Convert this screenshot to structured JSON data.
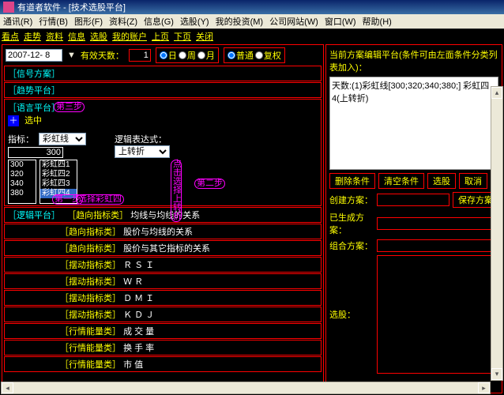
{
  "window": {
    "title": "有道者软件 - [技术选股平台]"
  },
  "menu": [
    "通讯(R)",
    "行情(B)",
    "图形(F)",
    "资料(Z)",
    "信息(G)",
    "选股(Y)",
    "我的投资(M)",
    "公司网站(W)",
    "窗口(W)",
    "帮助(H)"
  ],
  "toolbar": [
    "看点",
    "走势",
    "资料",
    "信息",
    "选股",
    "我的账户",
    "上页",
    "下页",
    "关闭"
  ],
  "top": {
    "date": "2007-12- 8",
    "days_label": "有效天数：",
    "days_value": "1",
    "period": {
      "day": "日",
      "week": "周",
      "month": "月"
    },
    "mode": {
      "normal": "普通",
      "adjusted": "复权"
    }
  },
  "sections": {
    "signal": "［信号方案］",
    "trend": "［趋势平台］",
    "lang": "［语言平台］",
    "logic": "［逻辑平台］"
  },
  "lang_panel": {
    "select_label": "选中",
    "indicator_label": "指标：",
    "indicator_value": "彩虹线",
    "num_value": "300",
    "list1": [
      "300",
      "320",
      "340",
      "380"
    ],
    "list2": [
      "彩虹四1",
      "彩虹四2",
      "彩虹四3",
      "彩虹四4"
    ],
    "list2_selected": 3,
    "logic_label": "逻辑表达式：",
    "logic_value": "上转折"
  },
  "annotations": {
    "step1": "第一步",
    "step2": "第二步",
    "step3": "第三步",
    "pick_ch4": "选择彩虹四",
    "click_sel": "点击选择上转折"
  },
  "categories": [
    {
      "cat": "［趋向指标类］",
      "desc": "均线与均线的关系"
    },
    {
      "cat": "［趋向指标类］",
      "desc": "股价与均线的关系"
    },
    {
      "cat": "［趋向指标类］",
      "desc": "股价与其它指标的关系"
    },
    {
      "cat": "［摆动指标类］",
      "desc": "Ｒ Ｓ Ｉ"
    },
    {
      "cat": "［摆动指标类］",
      "desc": "Ｗ Ｒ"
    },
    {
      "cat": "［摆动指标类］",
      "desc": "Ｄ Ｍ Ｉ"
    },
    {
      "cat": "［摆动指标类］",
      "desc": "Ｋ Ｄ Ｊ"
    },
    {
      "cat": "［行情能量类］",
      "desc": "成 交 量"
    },
    {
      "cat": "［行情能量类］",
      "desc": "换 手 率"
    },
    {
      "cat": "［行情能量类］",
      "desc": "市 值"
    }
  ],
  "right": {
    "header": "当前方案编辑平台(条件可由左面条件分类列表加入)：",
    "editor_text": "天数:(1)彩虹线[300;320;340;380;] 彩虹四4(上转折)",
    "buttons1": [
      "删除条件",
      "清空条件",
      "选股",
      "取消"
    ],
    "create_label": "创建方案：",
    "save_btn": "保存方案",
    "gen_label": "已生成方案：",
    "combo_label": "组合方案：",
    "pick_label": "选股："
  }
}
